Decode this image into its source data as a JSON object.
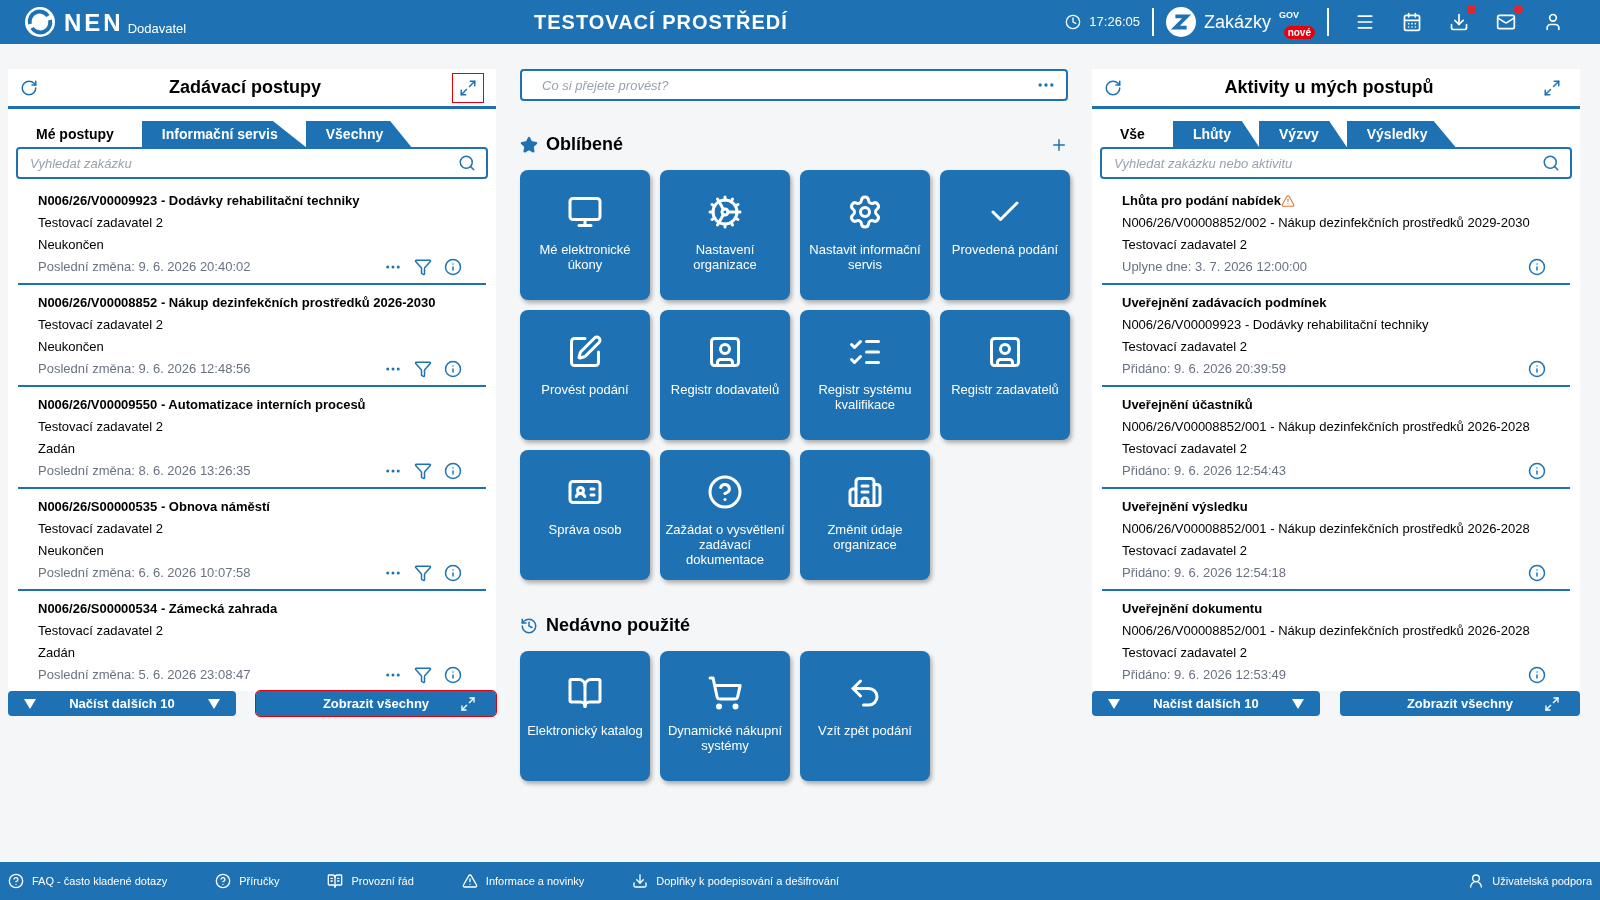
{
  "header": {
    "logo": "NEN",
    "role": "Dodavatel",
    "title": "TESTOVACÍ PROSTŘEDÍ",
    "clock": "17:26:05",
    "brand": "Zakázky",
    "brand_sup": "GOV",
    "brand_badge": "nové",
    "icons": [
      {
        "kind": "menu",
        "notify": false
      },
      {
        "kind": "calendar",
        "notify": false
      },
      {
        "kind": "download",
        "notify": true
      },
      {
        "kind": "mail",
        "notify": true
      },
      {
        "kind": "user",
        "notify": false
      }
    ]
  },
  "left_panel": {
    "title": "Zadávací postupy",
    "expand_focused": true,
    "tabs": [
      {
        "label": "Mé postupy",
        "selected": true
      },
      {
        "label": "Informační servis",
        "selected": false
      },
      {
        "label": "Všechny",
        "selected": false
      }
    ],
    "search": {
      "placeholder": "Vyhledat zakázku"
    },
    "items": [
      {
        "title": "N006/26/V00009923 - Dodávky rehabilitační techniky",
        "org": "Testovací zadavatel 2",
        "status": "Neukončen",
        "changed": "Poslední změna: 9. 6. 2026 20:40:02"
      },
      {
        "title": "N006/26/V00008852 - Nákup dezinfekčních prostředků 2026-2030",
        "org": "Testovací zadavatel 2",
        "status": "Neukončen",
        "changed": "Poslední změna: 9. 6. 2026 12:48:56"
      },
      {
        "title": "N006/26/V00009550 - Automatizace interních procesů",
        "org": "Testovací zadavatel 2",
        "status": "Zadán",
        "changed": "Poslední změna: 8. 6. 2026 13:26:35"
      },
      {
        "title": "N006/26/S00000535 - Obnova náměstí",
        "org": "Testovací zadavatel 2",
        "status": "Neukončen",
        "changed": "Poslední změna: 6. 6. 2026 10:07:58"
      },
      {
        "title": "N006/26/S00000534 - Zámecká zahrada",
        "org": "Testovací zadavatel 2",
        "status": "Zadán",
        "changed": "Poslední změna: 5. 6. 2026 23:08:47"
      }
    ],
    "load_more": "Načíst dalších 10",
    "show_all": {
      "label": "Zobrazit všechny",
      "focused": true
    }
  },
  "center": {
    "command": {
      "placeholder": "Co si přejete provést?"
    },
    "favorites_title": "Oblíbené",
    "favorites": [
      "Mé elektronické úkony",
      "Nastavení organizace",
      "Nastavit informační servis",
      "Provedená podání",
      "Provést podání",
      "Registr dodavatelů",
      "Registr systému kvalifikace",
      "Registr zadavatelů",
      "Správa osob",
      "Zažádat o vysvětlení zadávací dokumentace",
      "Změnit údaje organizace"
    ],
    "recent_title": "Nedávno použité",
    "recent": [
      "Elektronický katalog",
      "Dynamické nákupní systémy",
      "Vzít zpět podání"
    ]
  },
  "right_panel": {
    "title": "Aktivity u mých postupů",
    "expand_focused": false,
    "tabs": [
      {
        "label": "Vše",
        "selected": true
      },
      {
        "label": "Lhůty",
        "selected": false
      },
      {
        "label": "Výzvy",
        "selected": false
      },
      {
        "label": "Výsledky",
        "selected": false
      }
    ],
    "search": {
      "placeholder": "Vyhledat zakázku nebo aktivitu"
    },
    "items": [
      {
        "title": "Lhůta pro podání nabídek",
        "warning": true,
        "procedure": "N006/26/V00008852/002 - Nákup dezinfekčních prostředků 2029-2030",
        "org": "Testovací zadavatel 2",
        "date": "Uplyne dne: 3. 7. 2026 12:00:00"
      },
      {
        "title": "Uveřejnění zadávacích podmínek",
        "warning": false,
        "procedure": "N006/26/V00009923 - Dodávky rehabilitační techniky",
        "org": "Testovací zadavatel 2",
        "date": "Přidáno: 9. 6. 2026 20:39:59"
      },
      {
        "title": "Uveřejnění účastníků",
        "warning": false,
        "procedure": "N006/26/V00008852/001 - Nákup dezinfekčních prostředků 2026-2028",
        "org": "Testovací zadavatel 2",
        "date": "Přidáno: 9. 6. 2026 12:54:43"
      },
      {
        "title": "Uveřejnění výsledku",
        "warning": false,
        "procedure": "N006/26/V00008852/001 - Nákup dezinfekčních prostředků 2026-2028",
        "org": "Testovací zadavatel 2",
        "date": "Přidáno: 9. 6. 2026 12:54:18"
      },
      {
        "title": "Uveřejnění dokumentu",
        "warning": false,
        "procedure": "N006/26/V00008852/001 - Nákup dezinfekčních prostředků 2026-2028",
        "org": "Testovací zadavatel 2",
        "date": "Přidáno: 9. 6. 2026 12:53:49"
      }
    ],
    "load_more": "Načíst dalších 10",
    "show_all": {
      "label": "Zobrazit všechny",
      "focused": false
    }
  },
  "footer": {
    "links": [
      "FAQ - často kladené dotazy",
      "Příručky",
      "Provozní řád",
      "Informace a novinky",
      "Doplňky k podepisování a dešifrování"
    ],
    "support": "Uživatelská podpora"
  }
}
